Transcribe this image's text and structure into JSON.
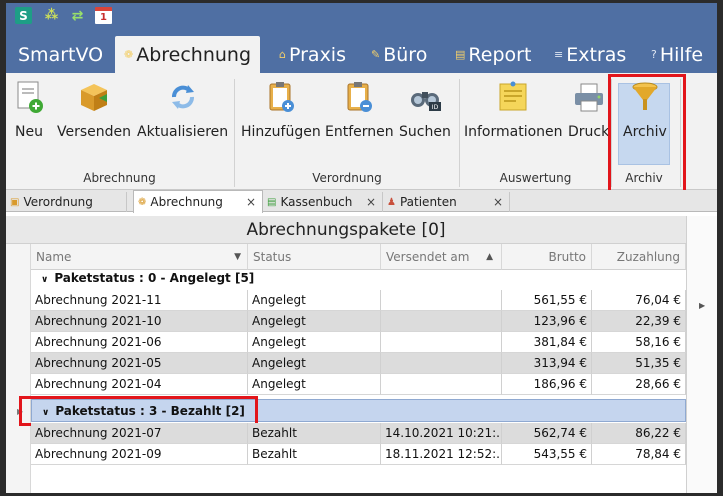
{
  "quick_access": {
    "app_icon_letter": "S",
    "calendar_day": "1"
  },
  "menu": {
    "tabs": [
      {
        "label": "SmartVO"
      },
      {
        "label": "Abrechnung"
      },
      {
        "label": "Praxis"
      },
      {
        "label": "Büro"
      },
      {
        "label": "Report"
      },
      {
        "label": "Extras"
      },
      {
        "label": "Hilfe"
      }
    ],
    "active": "Abrechnung"
  },
  "ribbon": {
    "groups": [
      {
        "label": "Abrechnung",
        "buttons": [
          {
            "label": "Neu",
            "icon": "new-doc-icon"
          },
          {
            "label": "Versenden",
            "icon": "package-icon"
          },
          {
            "label": "Aktualisieren",
            "icon": "refresh-icon"
          }
        ]
      },
      {
        "label": "Verordnung",
        "buttons": [
          {
            "label": "Hinzufügen",
            "icon": "clipboard-add-icon"
          },
          {
            "label": "Entfernen",
            "icon": "clipboard-remove-icon"
          },
          {
            "label": "Suchen",
            "icon": "binoculars-icon"
          }
        ]
      },
      {
        "label": "Auswertung",
        "buttons": [
          {
            "label": "Informationen",
            "icon": "note-icon"
          },
          {
            "label": "Druck",
            "icon": "printer-icon"
          }
        ]
      },
      {
        "label": "Archiv",
        "buttons": [
          {
            "label": "Archiv",
            "icon": "funnel-icon"
          }
        ]
      }
    ]
  },
  "doc_tabs": [
    {
      "label": "Verordnung",
      "active": false,
      "closable": false
    },
    {
      "label": "Abrechnung",
      "active": true,
      "closable": true
    },
    {
      "label": "Kassenbuch",
      "active": false,
      "closable": true
    },
    {
      "label": "Patienten",
      "active": false,
      "closable": true
    }
  ],
  "grid": {
    "title": "Abrechnungspakete [0]",
    "columns": [
      "Name",
      "Status",
      "Versendet am",
      "Brutto",
      "Zuzahlung"
    ],
    "groups": [
      {
        "label": "Paketstatus : 0 - Angelegt [5]",
        "rows": [
          {
            "name": "Abrechnung 2021-11",
            "status": "Angelegt",
            "sent": "",
            "brutto": "561,55 €",
            "zuzahlung": "76,04 €"
          },
          {
            "name": "Abrechnung 2021-10",
            "status": "Angelegt",
            "sent": "",
            "brutto": "123,96 €",
            "zuzahlung": "22,39 €"
          },
          {
            "name": "Abrechnung 2021-06",
            "status": "Angelegt",
            "sent": "",
            "brutto": "381,84 €",
            "zuzahlung": "58,16 €"
          },
          {
            "name": "Abrechnung 2021-05",
            "status": "Angelegt",
            "sent": "",
            "brutto": "313,94 €",
            "zuzahlung": "51,35 €"
          },
          {
            "name": "Abrechnung 2021-04",
            "status": "Angelegt",
            "sent": "",
            "brutto": "186,96 €",
            "zuzahlung": "28,66 €"
          }
        ]
      },
      {
        "label": "Paketstatus : 3 - Bezahlt [2]",
        "rows": [
          {
            "name": "Abrechnung 2021-07",
            "status": "Bezahlt",
            "sent": "14.10.2021 10:21:...",
            "brutto": "562,74 €",
            "zuzahlung": "86,22 €"
          },
          {
            "name": "Abrechnung 2021-09",
            "status": "Bezahlt",
            "sent": "18.11.2021 12:52:...",
            "brutto": "543,55 €",
            "zuzahlung": "78,84 €"
          }
        ]
      }
    ]
  },
  "colors": {
    "titlebar": "#4f6fa3",
    "ribbon_bg": "#f2f2f2",
    "highlight_red": "#e2151b",
    "selected_group": "#c5d5ee"
  }
}
